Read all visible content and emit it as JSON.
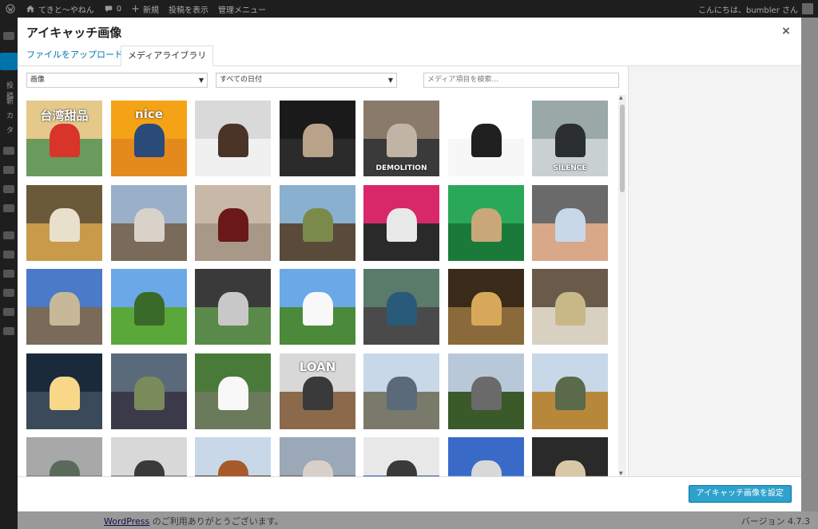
{
  "adminbar": {
    "site_name": "てきと～やねん",
    "comments_count": "0",
    "new_label": "新規",
    "view_post_label": "投稿を表示",
    "admin_menu_label": "管理メニュー",
    "greeting": "こんにちは、bumbler さん"
  },
  "adminmenu": {
    "partial_labels": [
      "投稿",
      "新",
      "カ",
      "タ"
    ]
  },
  "modal": {
    "title": "アイキャッチ画像",
    "close_glyph": "×",
    "tabs": {
      "upload": "ファイルをアップロード",
      "library": "メディアライブラリ"
    },
    "filter_type": {
      "selected": "画像"
    },
    "filter_date": {
      "selected": "すべての日付"
    },
    "search": {
      "placeholder": "メディア項目を検索…"
    },
    "set_button_label": "アイキャッチ画像を設定"
  },
  "footer": {
    "wordpress_link": "WordPress",
    "thanks_text": " のご利用ありがとうございます。",
    "version": "バージョン 4.7.3"
  },
  "colors": {
    "accent": "#0073aa",
    "button": "#2ea2cc",
    "adminbar": "#1e1e1e"
  },
  "media_grid": [
    [
      {
        "name": "taiwan-sweets",
        "c1": "#e4c98a",
        "c2": "#6a9a5c",
        "c3": "#d8342a",
        "txt": "台湾甜品"
      },
      {
        "name": "the-nice-guys",
        "c1": "#f5a316",
        "c2": "#e48a1c",
        "c3": "#2a4a7a",
        "txt": "nice"
      },
      {
        "name": "collateral-beauty",
        "c1": "#d9d9d9",
        "c2": "#f0f0f0",
        "c3": "#4a3428",
        "txt": ""
      },
      {
        "name": "allied-poster",
        "c1": "#1a1a1a",
        "c2": "#2b2b2b",
        "c3": "#b8a28a",
        "txt": ""
      },
      {
        "name": "demolition-poster",
        "c1": "#8a7a6a",
        "c2": "#3a3a3a",
        "c3": "#c0b5a5",
        "txt": "DEMOLITION"
      },
      {
        "name": "chromecast",
        "c1": "#ffffff",
        "c2": "#f7f7f7",
        "c3": "#202020",
        "txt": ""
      },
      {
        "name": "silence-poster",
        "c1": "#9aa8a8",
        "c2": "#c8d0d0",
        "c3": "#2a2e2e",
        "txt": "SILENCE"
      }
    ],
    [
      {
        "name": "bento-meal",
        "c1": "#6a5a3a",
        "c2": "#c89a4a",
        "c3": "#e8e0cc",
        "txt": ""
      },
      {
        "name": "old-house",
        "c1": "#9ab0c8",
        "c2": "#7a6a5a",
        "c3": "#d8d2c8",
        "txt": ""
      },
      {
        "name": "wine-glass",
        "c1": "#c8b8a8",
        "c2": "#a89888",
        "c3": "#6a1818",
        "txt": ""
      },
      {
        "name": "elephant-ride",
        "c1": "#8ab0d0",
        "c2": "#5a4a3a",
        "c3": "#7a8a4a",
        "txt": ""
      },
      {
        "name": "phone-accessory",
        "c1": "#d8286a",
        "c2": "#2a2a2a",
        "c3": "#e8e8e8",
        "txt": ""
      },
      {
        "name": "green-shop",
        "c1": "#2aa85a",
        "c2": "#1a7a3a",
        "c3": "#c8a878",
        "txt": ""
      },
      {
        "name": "hand-card",
        "c1": "#6a6a6a",
        "c2": "#d8a888",
        "c3": "#c8d8e8",
        "txt": ""
      }
    ],
    [
      {
        "name": "naga-statue",
        "c1": "#4a7ac8",
        "c2": "#7a6a5a",
        "c3": "#c8b89a",
        "txt": ""
      },
      {
        "name": "rice-field",
        "c1": "#6aa8e8",
        "c2": "#5aa83a",
        "c3": "#3a6a2a",
        "txt": ""
      },
      {
        "name": "tuktuk-seat",
        "c1": "#3a3a3a",
        "c2": "#5a8a4a",
        "c3": "#c8c8c8",
        "txt": ""
      },
      {
        "name": "trees-sky",
        "c1": "#6aa8e8",
        "c2": "#4a8a3a",
        "c3": "#f8f8f8",
        "txt": ""
      },
      {
        "name": "motorbikes",
        "c1": "#5a7a6a",
        "c2": "#4a4a4a",
        "c3": "#2a5a7a",
        "txt": ""
      },
      {
        "name": "temple-gate",
        "c1": "#3a2a1a",
        "c2": "#8a6a3a",
        "c3": "#d8a85a",
        "txt": ""
      },
      {
        "name": "rice-sacks",
        "c1": "#6a5a4a",
        "c2": "#d8d0c0",
        "c3": "#c8b888",
        "txt": ""
      }
    ],
    [
      {
        "name": "night-bridge",
        "c1": "#1a2a3a",
        "c2": "#3a4a5a",
        "c3": "#f8d888",
        "txt": ""
      },
      {
        "name": "street-vendor",
        "c1": "#5a6a7a",
        "c2": "#3a3a4a",
        "c3": "#7a8a5a",
        "txt": ""
      },
      {
        "name": "flooded-path",
        "c1": "#4a7a3a",
        "c2": "#6a7a5a",
        "c3": "#f8f8f8",
        "txt": ""
      },
      {
        "name": "cup-loan-shop",
        "c1": "#d8d8d8",
        "c2": "#8a6a4a",
        "c3": "#3a3a3a",
        "txt": "LOAN"
      },
      {
        "name": "flooded-street",
        "c1": "#c8d8e8",
        "c2": "#7a7a6a",
        "c3": "#5a6a7a",
        "txt": ""
      },
      {
        "name": "palm-road",
        "c1": "#b8c8d8",
        "c2": "#3a5a2a",
        "c3": "#6a6a6a",
        "txt": ""
      },
      {
        "name": "hoian-street",
        "c1": "#c8d8e8",
        "c2": "#b8883a",
        "c3": "#5a6a4a",
        "txt": ""
      }
    ],
    [
      {
        "name": "grey-sky-town",
        "c1": "#a8a8a8",
        "c2": "#7a7a7a",
        "c3": "#5a6a5a",
        "txt": ""
      },
      {
        "name": "old-roof",
        "c1": "#d8d8d8",
        "c2": "#7a6a5a",
        "c3": "#3a3a3a",
        "txt": ""
      },
      {
        "name": "pagoda-roof",
        "c1": "#c8d8e8",
        "c2": "#5a3a2a",
        "c3": "#a85a2a",
        "txt": ""
      },
      {
        "name": "crowd-street",
        "c1": "#9aa8b8",
        "c2": "#6a5a5a",
        "c3": "#d8d0c8",
        "txt": ""
      },
      {
        "name": "shop-front",
        "c1": "#e8e8e8",
        "c2": "#2a5aa8",
        "c3": "#3a3a3a",
        "txt": ""
      },
      {
        "name": "airport-plane",
        "c1": "#3a6ac8",
        "c2": "#5a8ad8",
        "c3": "#d8d8d8",
        "txt": ""
      },
      {
        "name": "dark-storefront",
        "c1": "#2a2a2a",
        "c2": "#5a4a3a",
        "c3": "#d8c8a8",
        "txt": ""
      }
    ]
  ]
}
